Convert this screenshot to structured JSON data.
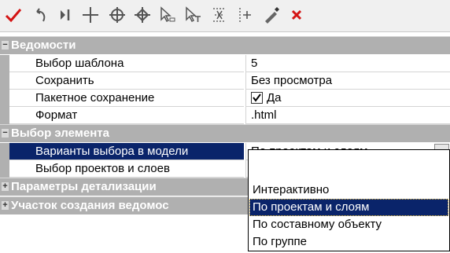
{
  "toolbar": {
    "icons": [
      "checkmark-icon",
      "undo-icon",
      "cursor-line-icon",
      "crosshair-icon",
      "circle-crosshair-icon",
      "diamond-crosshair-icon",
      "select-arrow-icon",
      "select-text-icon",
      "snap-icon",
      "nodes-icon",
      "pen-icon",
      "close-icon"
    ],
    "accent_color": "#d41414"
  },
  "grid": {
    "categories": [
      {
        "label": "Ведомости",
        "toggle": "−"
      },
      {
        "label": "Выбор элемента",
        "toggle": "−"
      },
      {
        "label": "Параметры детализации",
        "toggle": "+"
      },
      {
        "label": "Участок создания ведомос",
        "toggle": "+"
      }
    ],
    "rows": [
      {
        "name": "Выбор шаблона",
        "value": "5"
      },
      {
        "name": "Сохранить",
        "value": "Без просмотра"
      },
      {
        "name": "Пакетное сохранение",
        "value": "Да",
        "checked": true
      },
      {
        "name": "Формат",
        "value": ".html"
      },
      {
        "name": "Варианты выбора в модели",
        "value": "По проектам и слоям"
      },
      {
        "name": "Выбор проектов и слоев",
        "value": ""
      }
    ],
    "dropdown": {
      "options": [
        "Интерактивно",
        "По проектам и слоям",
        "По составному объекту",
        "По группе"
      ],
      "selected": "По проектам и слоям"
    },
    "colors": {
      "category_bg": "#b0b0b0",
      "selection": "#0a246a"
    }
  }
}
